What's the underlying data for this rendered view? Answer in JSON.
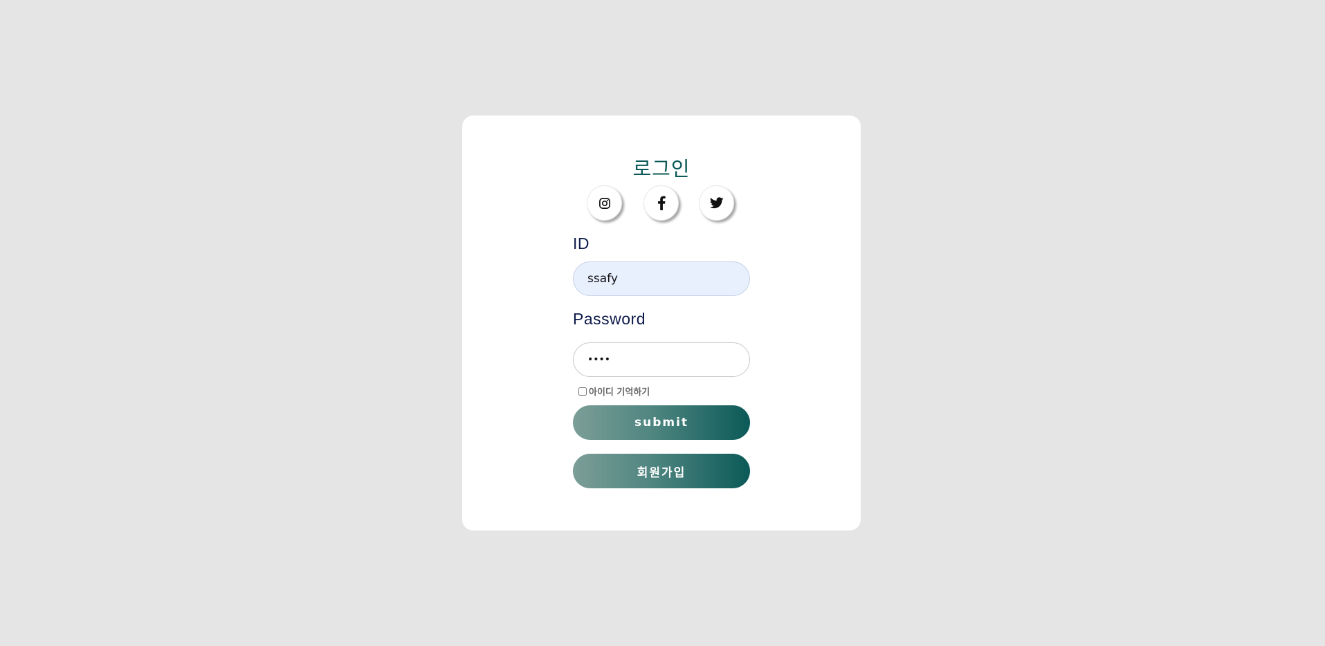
{
  "login": {
    "title": "로그인",
    "social": [
      {
        "name": "instagram-icon"
      },
      {
        "name": "facebook-icon"
      },
      {
        "name": "twitter-icon"
      }
    ],
    "id_label": "ID",
    "id_value": "ssafy",
    "password_label": "Password",
    "password_value": "••••",
    "remember_label": "아이디 기억하기",
    "remember_checked": false,
    "submit_label": "submit",
    "signup_label": "회원가입"
  },
  "colors": {
    "background": "#e5e5e5",
    "card": "#ffffff",
    "title": "#0c5959",
    "label": "#0d1a4a",
    "button_gradient_start": "#7c9e97",
    "button_gradient_end": "#0b5a58",
    "id_field_bg": "#e8f0fe"
  }
}
